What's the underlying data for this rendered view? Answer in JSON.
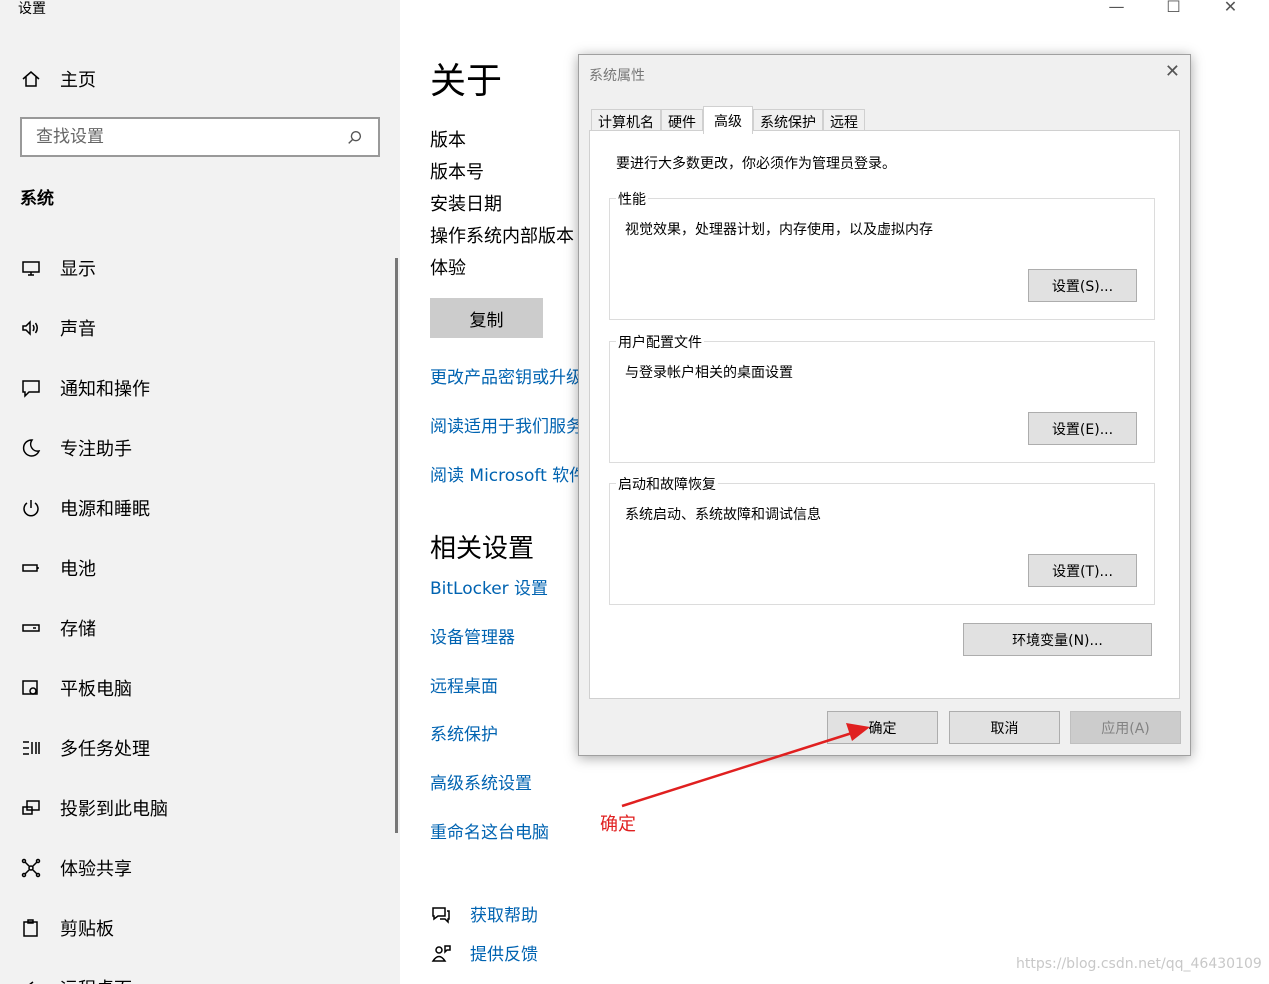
{
  "window": {
    "title": "设置",
    "controls": [
      "—",
      "☐",
      "✕"
    ]
  },
  "sidebar": {
    "home_label": "主页",
    "search_placeholder": "查找设置",
    "section_title": "系统",
    "items": [
      {
        "label": "显示",
        "icon": "monitor-icon"
      },
      {
        "label": "声音",
        "icon": "speaker-icon"
      },
      {
        "label": "通知和操作",
        "icon": "notification-icon"
      },
      {
        "label": "专注助手",
        "icon": "moon-icon"
      },
      {
        "label": "电源和睡眠",
        "icon": "power-icon"
      },
      {
        "label": "电池",
        "icon": "battery-icon"
      },
      {
        "label": "存储",
        "icon": "storage-icon"
      },
      {
        "label": "平板电脑",
        "icon": "tablet-icon"
      },
      {
        "label": "多任务处理",
        "icon": "multitask-icon"
      },
      {
        "label": "投影到此电脑",
        "icon": "project-icon"
      },
      {
        "label": "体验共享",
        "icon": "share-icon"
      },
      {
        "label": "剪贴板",
        "icon": "clipboard-icon"
      },
      {
        "label": "远程桌面",
        "icon": "remote-icon"
      }
    ]
  },
  "about": {
    "title": "关于",
    "specs": [
      "版本",
      "版本号",
      "安装日期",
      "操作系统内部版本",
      "体验"
    ],
    "copy_label": "复制",
    "links": [
      "更改产品密钥或升级",
      "阅读适用于我们服务",
      "阅读 Microsoft 软件"
    ],
    "related_title": "相关设置",
    "related_links": [
      "BitLocker 设置",
      "设备管理器",
      "远程桌面",
      "系统保护",
      "高级系统设置",
      "重命名这台电脑"
    ],
    "help_label": "获取帮助",
    "feedback_label": "提供反馈"
  },
  "dialog": {
    "title": "系统属性",
    "close": "✕",
    "tabs": [
      "计算机名",
      "硬件",
      "高级",
      "系统保护",
      "远程"
    ],
    "active_tab": "高级",
    "admin_note": "要进行大多数更改，你必须作为管理员登录。",
    "groups": [
      {
        "title": "性能",
        "desc": "视觉效果，处理器计划，内存使用，以及虚拟内存",
        "button": "设置(S)..."
      },
      {
        "title": "用户配置文件",
        "desc": "与登录帐户相关的桌面设置",
        "button": "设置(E)..."
      },
      {
        "title": "启动和故障恢复",
        "desc": "系统启动、系统故障和调试信息",
        "button": "设置(T)..."
      }
    ],
    "env_button": "环境变量(N)...",
    "ok_button": "确定",
    "cancel_button": "取消",
    "apply_button": "应用(A)"
  },
  "annotation": {
    "label": "确定",
    "color": "#e02020"
  },
  "watermark": "https://blog.csdn.net/qq_46430109"
}
